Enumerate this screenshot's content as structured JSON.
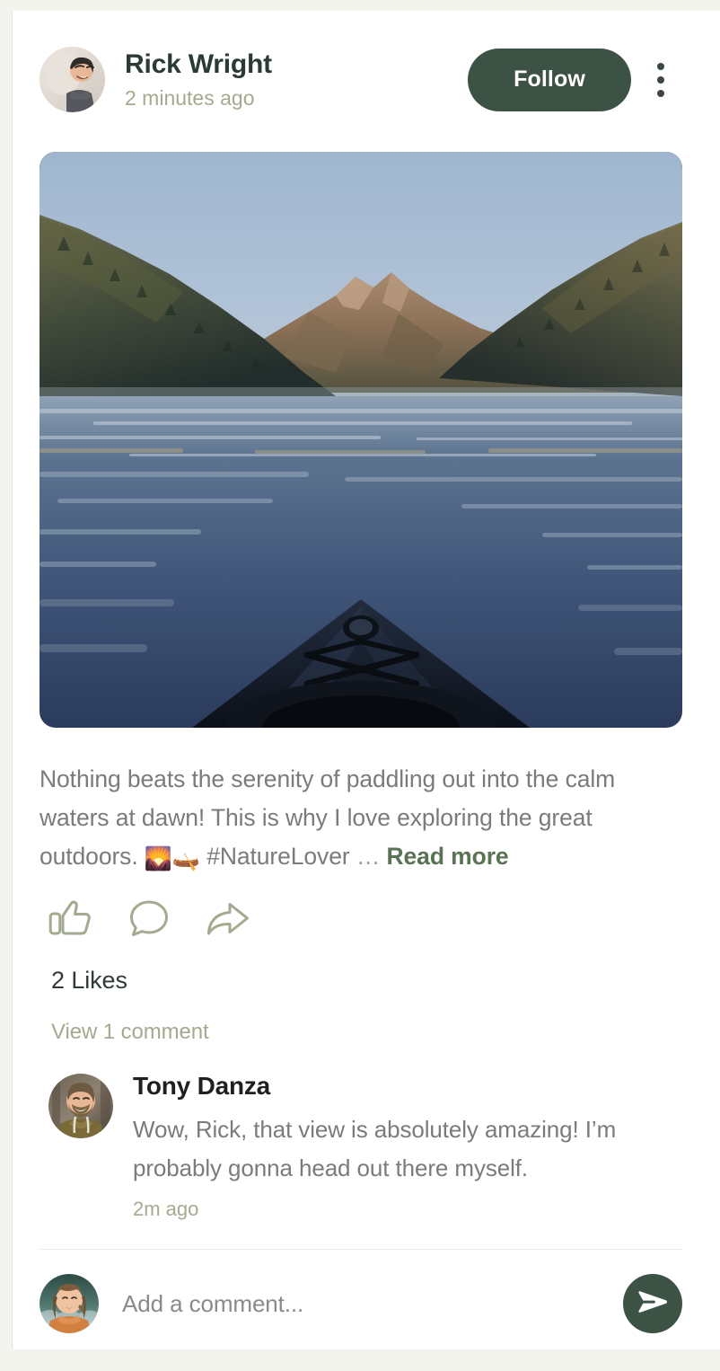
{
  "post": {
    "author": {
      "name": "Rick Wright",
      "avatar_alt": "man-in-gray-tshirt-avatar"
    },
    "timestamp": "2 minutes ago",
    "follow_label": "Follow",
    "more_menu_label": "More options",
    "photo_alt": "kayak-bow-on-calm-mountain-lake-at-dawn",
    "caption": {
      "text_before_emoji": "Nothing beats the serenity of paddling out into the calm waters at dawn!  This is why I love exploring the great outdoors. ",
      "emoji_1": "🌄",
      "emoji_2": "🛶",
      "hashtag": "#NatureLover",
      "ellipsis": "…",
      "read_more_label": "Read more"
    },
    "actions": {
      "like_label": "Like",
      "comment_label": "Comment",
      "share_label": "Share"
    },
    "likes_text": "2 Likes",
    "view_comments_label": "View 1 comment"
  },
  "comments": [
    {
      "author": "Tony Danza",
      "avatar_alt": "bearded-man-in-olive-hoodie-avatar",
      "text": "Wow, Rick, that view is absolutely amazing! I’m probably gonna head out there myself.",
      "time": "2m ago"
    }
  ],
  "composer": {
    "avatar_alt": "woman-with-braided-hair-avatar",
    "placeholder": "Add a comment...",
    "value": "",
    "send_label": "Send"
  },
  "colors": {
    "brand_green": "#3b5244",
    "sage": "#a3ab8f",
    "read_more_green": "#5a7355",
    "body_text": "#7b7b7b",
    "heading_text": "#2b3b33",
    "page_background": "#f4f4ee",
    "card_background": "#ffffff",
    "divider": "#eae9e2"
  }
}
